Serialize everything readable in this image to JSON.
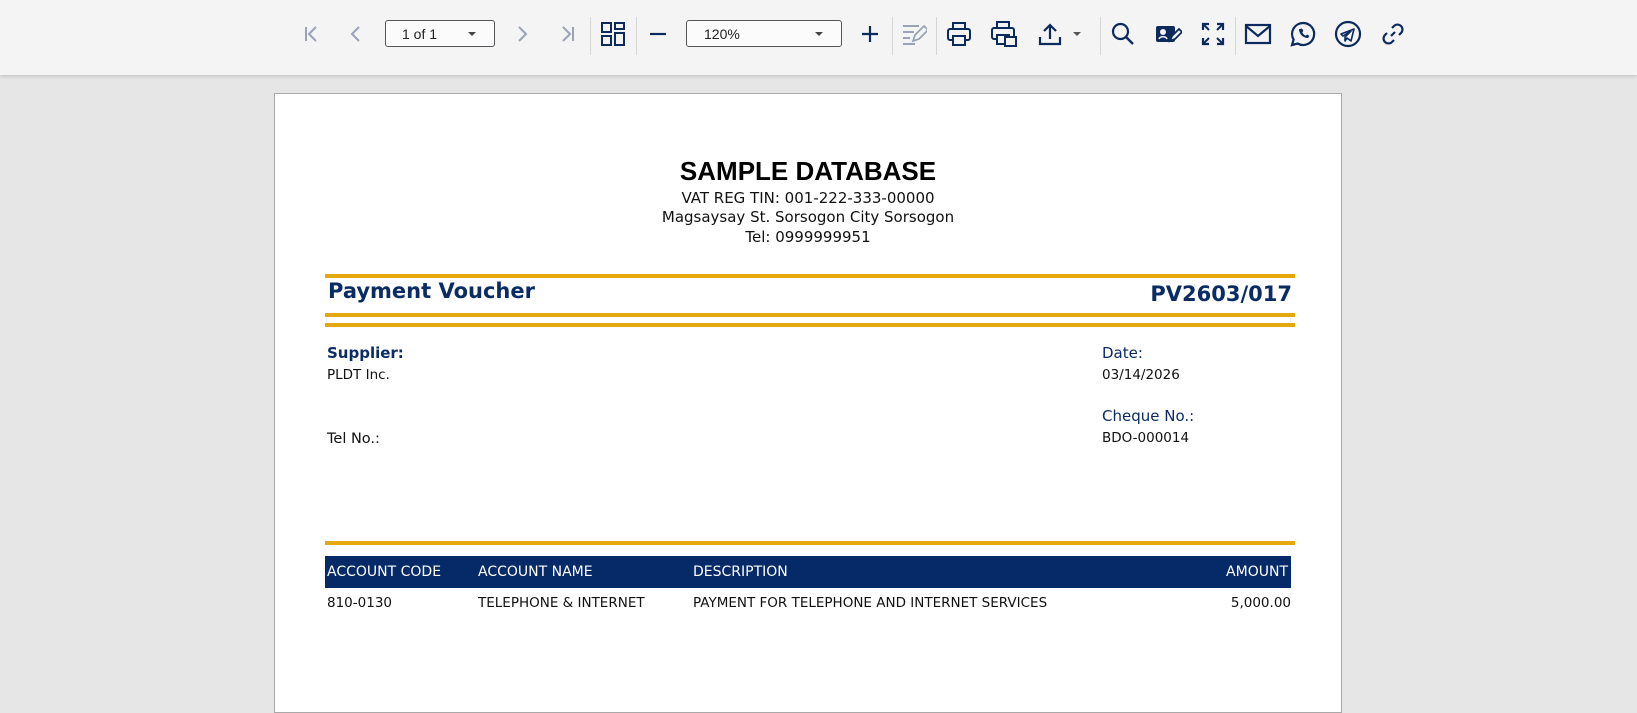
{
  "toolbar": {
    "page_indicator": "1 of 1",
    "zoom_level": "120%",
    "icons": [
      "first-page-icon",
      "previous-page-icon",
      "next-page-icon",
      "last-page-icon",
      "thumbnails-icon",
      "zoom-out-icon",
      "zoom-in-icon",
      "edit-form-icon",
      "print-icon",
      "print-preview-icon",
      "export-icon",
      "search-icon",
      "sign-document-icon",
      "fullscreen-icon",
      "email-icon",
      "whatsapp-icon",
      "telegram-icon",
      "link-icon"
    ]
  },
  "document": {
    "company": {
      "name": "SAMPLE DATABASE",
      "tin": "VAT REG TIN: 001-222-333-00000",
      "address": "Magsaysay St. Sorsogon City Sorsogon",
      "tel": "Tel: 0999999951"
    },
    "title": "Payment Voucher",
    "voucher_number": "PV2603/017",
    "supplier_label": "Supplier:",
    "supplier_name": "PLDT Inc.",
    "tel_label": "Tel No.:",
    "date_label": "Date:",
    "date_value": "03/14/2026",
    "cheque_label": "Cheque No.:",
    "cheque_value": "BDO-000014",
    "table": {
      "columns": [
        "ACCOUNT CODE",
        "ACCOUNT NAME",
        "DESCRIPTION",
        "AMOUNT"
      ],
      "rows": [
        {
          "account_code": "810-0130",
          "account_name": "TELEPHONE & INTERNET",
          "description": "PAYMENT FOR TELEPHONE AND INTERNET SERVICES",
          "amount": "5,000.00"
        }
      ]
    }
  },
  "colors": {
    "navy": "#0a2b63",
    "table_header": "#062a67",
    "gold_rule": "#e6a80f",
    "icon": "#0c2a5c",
    "icon_disabled": "#9aa3b5"
  }
}
